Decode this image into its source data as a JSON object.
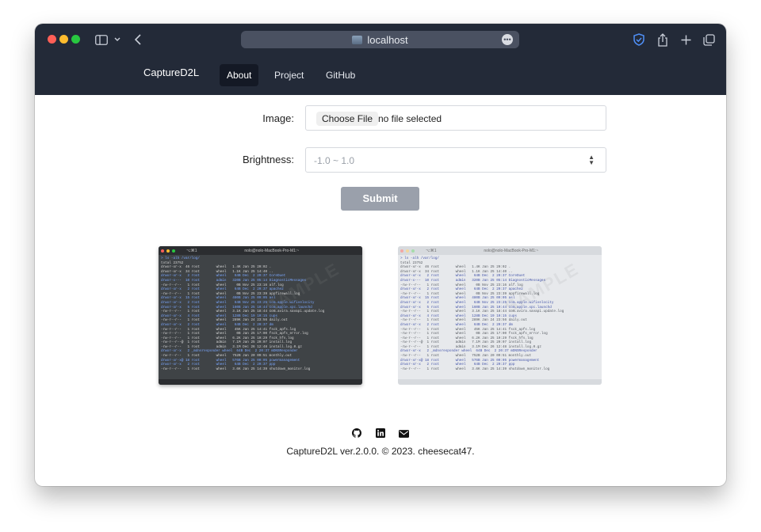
{
  "browser": {
    "url": "localhost"
  },
  "site": {
    "brand": "CaptureD2L",
    "nav": [
      {
        "label": "About",
        "active": true
      },
      {
        "label": "Project",
        "active": false
      },
      {
        "label": "GitHub",
        "active": false
      }
    ]
  },
  "form": {
    "image_label": "Image:",
    "choose_file": "Choose File",
    "no_file": "no file selected",
    "brightness_label": "Brightness:",
    "brightness_placeholder": "-1.0 ~ 1.0",
    "submit": "Submit"
  },
  "previews": {
    "title": "nolo@nolo-MacBook-Pro-M1:~",
    "tab": "⌥⌘1",
    "command": "> ls -alh /var/log/",
    "total": "total 23752",
    "lines": [
      "drwxr-xr-x  46 root        wheel   1.4K Jan 25 20:02 .",
      "drwxr-xr-x  34 root        wheel   1.1K Jan 25 14:40 ..",
      "drwxr-xr-x   2 root        wheel    64B Dec  2 20:37 CoreDuet",
      "drwxr-x---  10 root        admin   320B Jan 25 05:14 DiagnosticMessages",
      "-rw-r--r--   1 root        wheel     0B Nov 25 23:16 alf.log",
      "drwxr-xr-x   2 root        wheel    64B Dec  2 20:37 apache2",
      "-rw-r--r--   1 root        wheel     0B Nov 25 23:39 appfirewall.log",
      "drwxr-xr-x  15 root        wheel   480B Jan 25 09:05 asl",
      "drwxr-xr-x   2 root        wheel    64B Nov 25 23:25 com.apple.wifivelocity",
      "drwxr-xr-x   5 root        wheel   160B Jan 25 10:44 com.apple.xpc.launchd",
      "-rw-r--r--   1 root        wheel   3.1K Jan 25 18:44 com.avira.savapi.update.log",
      "drwxr-xr-x   4 root        wheel   128B Dec 19 10:15 cups",
      "-rw-r--r--   1 root        wheel   289K Jan 24 23:56 daily.out",
      "drwxr-xr-x   2 root        wheel    64B Dec  2 20:37 dm",
      "-rw-r--r--   1 root        wheel    45K Jan 25 14:41 fsck_apfs.log",
      "-rw-r--r--   1 root        wheel     0B Jan 25 17:00 fsck_apfs_error.log",
      "-rw-r--r--   1 root        wheel   6.2K Jan 25 10:29 fsck_hfs.log",
      "-rw-r--r--@  1 root        admin   7.1M Jan 25 20:07 install.log",
      "-rw-r--r--   1 root        admin   3.1M Dec 26 12:48 install.log.0.gz",
      "drwxr-xr-x   2 _mdnsresponder wheel  64B Dec  2 20:37 mDNSResponder",
      "-rw-r--r--   1 root        wheel   752B Jan 20 09:51 monthly.out",
      "drwxr-xr-x@ 18 root        wheel   576B Jan 25 00:05 powermanagement",
      "drwxr-xr-x   2 root        wheel    64B Dec  2 20:37 ppp",
      "-rw-r--r--   1 root        wheel   3.6K Jan 25 14:39 shutdown_monitor.log"
    ],
    "watermark": "SAMPLE"
  },
  "footer": {
    "icons": [
      "github-icon",
      "linkedin-icon",
      "mail-icon"
    ],
    "text": "CaptureD2L ver.2.0.0. © 2023. cheesecat47."
  }
}
